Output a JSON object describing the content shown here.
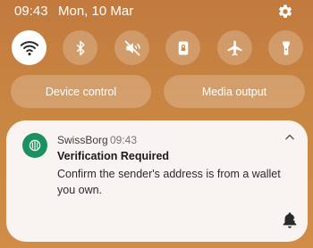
{
  "status_bar": {
    "time": "09:43",
    "date": "Mon, 10 Mar"
  },
  "icons": {
    "settings": "gear-icon",
    "wifi": "wifi-icon",
    "bluetooth": "bluetooth-icon",
    "mute": "mute-icon",
    "lock": "portrait-lock-icon",
    "airplane": "airplane-icon",
    "flashlight": "flashlight-icon",
    "app": "swissborg-logo-icon",
    "collapse": "chevron-up-icon",
    "bell": "bell-snooze-icon"
  },
  "quick_settings": {
    "wifi_active": true,
    "bluetooth_active": false,
    "sound_muted": true,
    "rotation_locked": true,
    "airplane_active": false,
    "flashlight_active": false
  },
  "controls": {
    "device_control_label": "Device control",
    "media_output_label": "Media output"
  },
  "notification": {
    "app_name": "SwissBorg",
    "time": "09:43",
    "title": "Verification Required",
    "body": "Confirm the sender's address is from a wallet you own."
  },
  "colors": {
    "accent_green": "#1c9160",
    "card_bg": "#f9f4f1",
    "active_tile": "#ffffff"
  }
}
